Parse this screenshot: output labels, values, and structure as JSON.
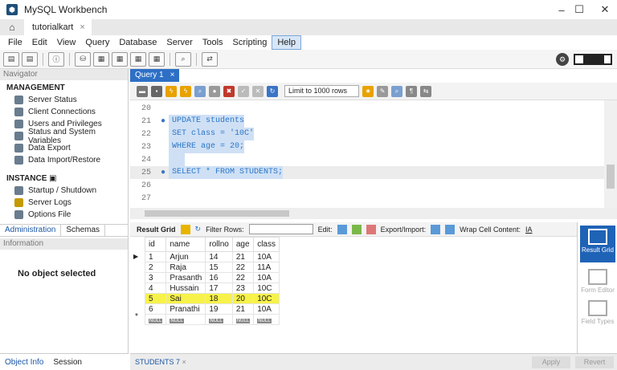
{
  "window": {
    "title": "MySQL Workbench",
    "minimize": "–",
    "maximize": "☐",
    "close": "✕"
  },
  "connection_tab": {
    "label": "tutorialkart",
    "close": "×"
  },
  "menu": [
    "File",
    "Edit",
    "View",
    "Query",
    "Database",
    "Server",
    "Tools",
    "Scripting",
    "Help"
  ],
  "navigator": {
    "header": "Navigator",
    "management_title": "MANAGEMENT",
    "management": [
      "Server Status",
      "Client Connections",
      "Users and Privileges",
      "Status and System Variables",
      "Data Export",
      "Data Import/Restore"
    ],
    "instance_title": "INSTANCE",
    "instance": [
      "Startup / Shutdown",
      "Server Logs",
      "Options File"
    ],
    "tabs": [
      "Administration",
      "Schemas"
    ]
  },
  "information": {
    "header": "Information",
    "empty": "No object selected"
  },
  "object_tabs": [
    "Object Info",
    "Session"
  ],
  "query_tab": {
    "label": "Query 1",
    "close": "×"
  },
  "query_toolbar": {
    "limit": "Limit to 1000 rows"
  },
  "editor": {
    "lines": [
      {
        "n": "20",
        "dot": "",
        "code": ""
      },
      {
        "n": "21",
        "dot": "●",
        "code": "UPDATE students"
      },
      {
        "n": "22",
        "dot": "",
        "code": "SET class = '10C'"
      },
      {
        "n": "23",
        "dot": "",
        "code": "WHERE age = 20;"
      },
      {
        "n": "24",
        "dot": "",
        "code": ""
      },
      {
        "n": "25",
        "dot": "●",
        "code": "SELECT * FROM STUDENTS;"
      },
      {
        "n": "26",
        "dot": "",
        "code": ""
      },
      {
        "n": "27",
        "dot": "",
        "code": ""
      }
    ]
  },
  "result_toolbar": {
    "result_grid": "Result Grid",
    "filter_rows": "Filter Rows:",
    "edit": "Edit:",
    "export_import": "Export/Import:",
    "wrap": "Wrap Cell Content:"
  },
  "result": {
    "columns": [
      "id",
      "name",
      "rollno",
      "age",
      "class"
    ],
    "rows": [
      [
        "1",
        "Arjun",
        "14",
        "21",
        "10A"
      ],
      [
        "2",
        "Raja",
        "15",
        "22",
        "11A"
      ],
      [
        "3",
        "Prasanth",
        "16",
        "22",
        "10A"
      ],
      [
        "4",
        "Hussain",
        "17",
        "23",
        "10C"
      ],
      [
        "5",
        "Sai",
        "18",
        "20",
        "10C"
      ],
      [
        "6",
        "Pranathi",
        "19",
        "21",
        "10A"
      ]
    ],
    "null_label": "NULL",
    "highlight_color": "#f7f24a"
  },
  "side_panel": [
    "Result Grid",
    "Form Editor",
    "Field Types"
  ],
  "bottom": {
    "tab": "STUDENTS 7",
    "close": "×",
    "apply": "Apply",
    "revert": "Revert"
  }
}
